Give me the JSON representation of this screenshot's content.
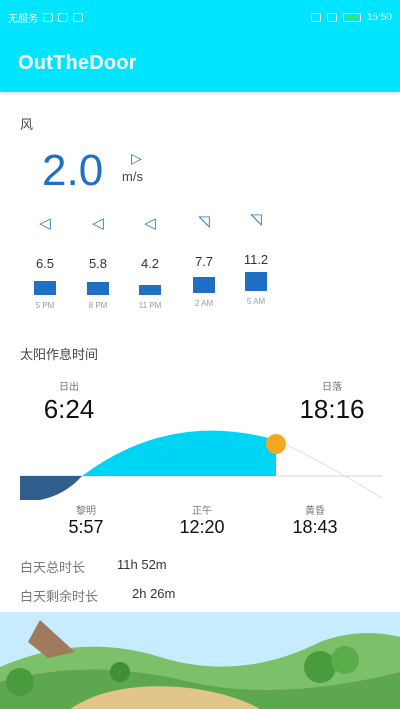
{
  "status_bar": {
    "carrier": "无服务",
    "time": "15:50"
  },
  "app_bar": {
    "title": "OutTheDoor"
  },
  "wind": {
    "section_label": "风",
    "speed": "2.0",
    "unit": "m/s",
    "direction_icon": "triangle-arrow-icon",
    "forecast": [
      {
        "value": "6.5",
        "time": "5 PM",
        "direction": "left"
      },
      {
        "value": "5.8",
        "time": "8 PM",
        "direction": "left"
      },
      {
        "value": "4.2",
        "time": "11 PM",
        "direction": "left"
      },
      {
        "value": "7.7",
        "time": "2 AM",
        "direction": "up-right"
      },
      {
        "value": "11.2",
        "time": "5 AM",
        "direction": "up-right"
      }
    ]
  },
  "sun": {
    "section_label": "太阳作息时间",
    "sunrise_label": "日出",
    "sunrise_time": "6:24",
    "sunset_label": "日落",
    "sunset_time": "18:16",
    "dawn_label": "黎明",
    "dawn_time": "5:57",
    "noon_label": "正午",
    "noon_time": "12:20",
    "dusk_label": "黄昏",
    "dusk_time": "18:43",
    "daylight_total_label": "白天总时长",
    "daylight_total_value": "11h 52m",
    "daylight_remaining_label": "白天剩余时长",
    "daylight_remaining_value": "2h 26m"
  },
  "colors": {
    "accent": "#00e5ff",
    "wind_blue": "#1f6fc4",
    "day_arc": "#00d4f5",
    "night": "#2f5d8c",
    "sun": "#f5a623"
  }
}
